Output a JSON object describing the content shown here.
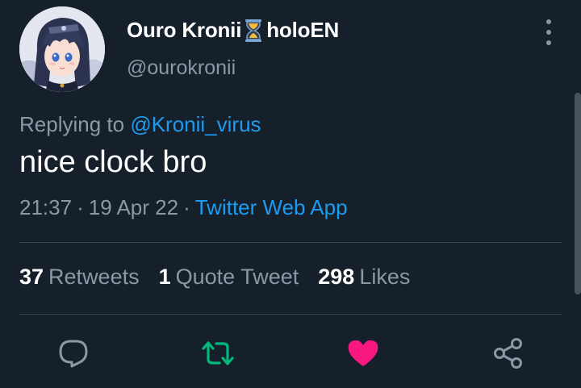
{
  "author": {
    "display_name_prefix": "Ouro Kronii",
    "emoji": "hourglass-icon",
    "display_name_suffix": "holoEN",
    "handle": "@ourokronii"
  },
  "reply": {
    "label": "Replying to",
    "target": "@Kronii_virus"
  },
  "tweet": {
    "text": "nice clock bro",
    "time": "21:37",
    "separator": "·",
    "date": "19 Apr 22",
    "source": "Twitter Web App"
  },
  "stats": {
    "retweets_count": "37",
    "retweets_label": "Retweets",
    "quotes_count": "1",
    "quotes_label": "Quote Tweet",
    "likes_count": "298",
    "likes_label": "Likes"
  },
  "actions": {
    "reply_icon": "reply-icon",
    "retweet_icon": "retweet-icon",
    "like_icon": "heart-icon",
    "share_icon": "share-icon",
    "liked": true
  },
  "colors": {
    "background": "#15202b",
    "link": "#1d9bf0",
    "muted": "#8b98a5",
    "retweet": "#00ba7c",
    "like": "#f91880",
    "hourglass": "#f4b942"
  }
}
